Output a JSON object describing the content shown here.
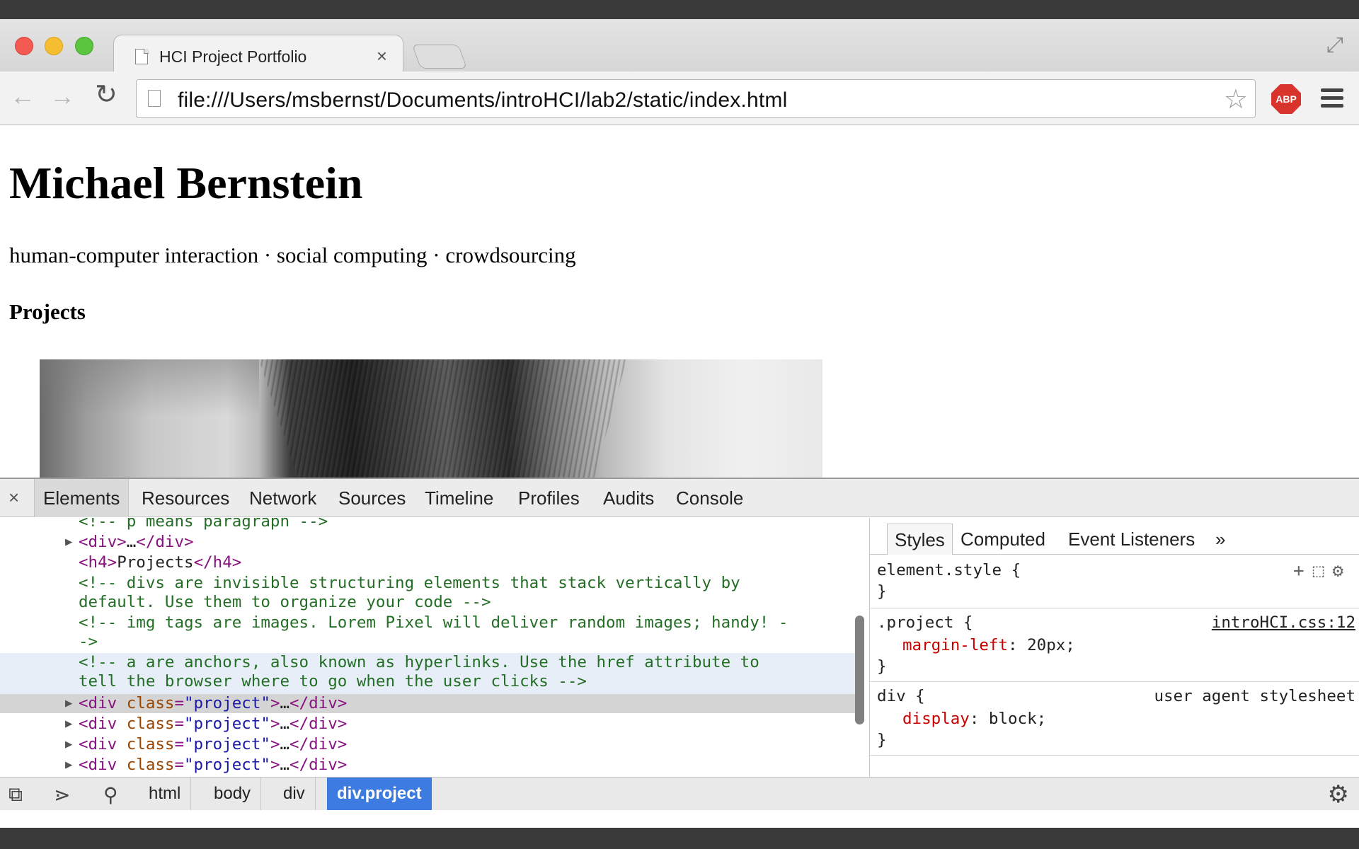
{
  "browser": {
    "tab_title": "HCI Project Portfolio",
    "tab_close": "×",
    "url": "file:///Users/msbernst/Documents/introHCI/lab2/static/index.html",
    "abp_label": "ABP"
  },
  "page": {
    "heading": "Michael Bernstein",
    "tagline": "human-computer interaction · social computing · crowdsourcing",
    "section_heading": "Projects"
  },
  "devtools": {
    "close": "×",
    "tabs": [
      "Elements",
      "Resources",
      "Network",
      "Sources",
      "Timeline",
      "Profiles",
      "Audits",
      "Console"
    ],
    "dom": {
      "line0": "<!-- p means paragraph -->",
      "line1_tag_open": "<div>",
      "line1_ellipsis": "…",
      "line1_tag_close": "</div>",
      "line2_open": "<h4>",
      "line2_text": "Projects",
      "line2_close": "</h4>",
      "comment1a": "<!-- divs are invisible structuring elements that stack vertically by",
      "comment1b": "default. Use them to organize your code -->",
      "comment2a": "<!-- img tags are images. Lorem Pixel will deliver random images; handy! -",
      "comment2b": "->",
      "comment3a": "<!-- a are anchors, also known as hyperlinks. Use the href attribute to",
      "comment3b": "tell the browser where to go when the user clicks -->",
      "proj_open": "<div ",
      "proj_attr": "class",
      "proj_eq": "=",
      "proj_val": "\"project\"",
      "proj_gt": ">",
      "proj_ellipsis": "…",
      "proj_close": "</div>"
    },
    "styles": {
      "tabs": [
        "Styles",
        "Computed",
        "Event Listeners",
        "»"
      ],
      "element_style_open": "element.style {",
      "close_brace": "}",
      "rule1_selector": ".project {",
      "rule1_source": "introHCI.css:12",
      "rule1_prop": "margin-left",
      "rule1_value": ": 20px;",
      "rule2_selector": "div {",
      "rule2_source": "user agent stylesheet",
      "rule2_prop": "display",
      "rule2_value": ": block;"
    },
    "breadcrumbs": [
      "html",
      "body",
      "div",
      "div.project"
    ]
  }
}
